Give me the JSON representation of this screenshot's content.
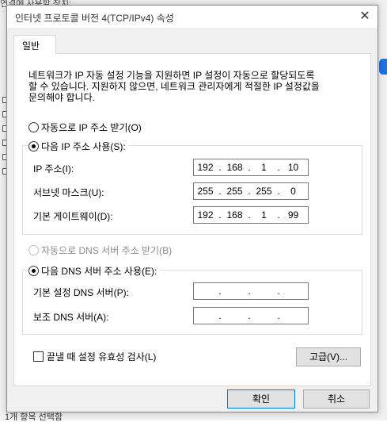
{
  "background": {
    "top_text": "연결에 사용할 장치:",
    "bottom_text": "1개 항목 선택함"
  },
  "dialog": {
    "title": "인터넷 프로토콜 버전 4(TCP/IPv4) 속성",
    "close_glyph": "✕",
    "tab_label": "일반",
    "description_line1": "네트워크가 IP 자동 설정 기능을 지원하면 IP 설정이 자동으로 할당되도록",
    "description_line2": "할 수 있습니다. 지원하지 않으면, 네트워크 관리자에게 적절한 IP 설정값을",
    "description_line3": "문의해야 합니다.",
    "ip_auto_label": "자동으로 IP 주소 받기(O)",
    "ip_manual_label": "다음 IP 주소 사용(S):",
    "ip_address_label": "IP 주소(I):",
    "ip_address": [
      "192",
      "168",
      "1",
      "10"
    ],
    "subnet_label": "서브넷 마스크(U):",
    "subnet": [
      "255",
      "255",
      "255",
      "0"
    ],
    "gateway_label": "기본 게이트웨이(D):",
    "gateway": [
      "192",
      "168",
      "1",
      "99"
    ],
    "dns_auto_label": "자동으로 DNS 서버 주소 받기(B)",
    "dns_manual_label": "다음 DNS 서버 주소 사용(E):",
    "dns_preferred_label": "기본 설정 DNS 서버(P):",
    "dns_preferred": [
      "",
      "",
      "",
      ""
    ],
    "dns_alternate_label": "보조 DNS 서버(A):",
    "dns_alternate": [
      "",
      "",
      "",
      ""
    ],
    "validate_label": "끝낼 때 설정 유효성 검사(L)",
    "advanced_button": "고급(V)...",
    "ok_button": "확인",
    "cancel_button": "취소",
    "dot": "."
  }
}
